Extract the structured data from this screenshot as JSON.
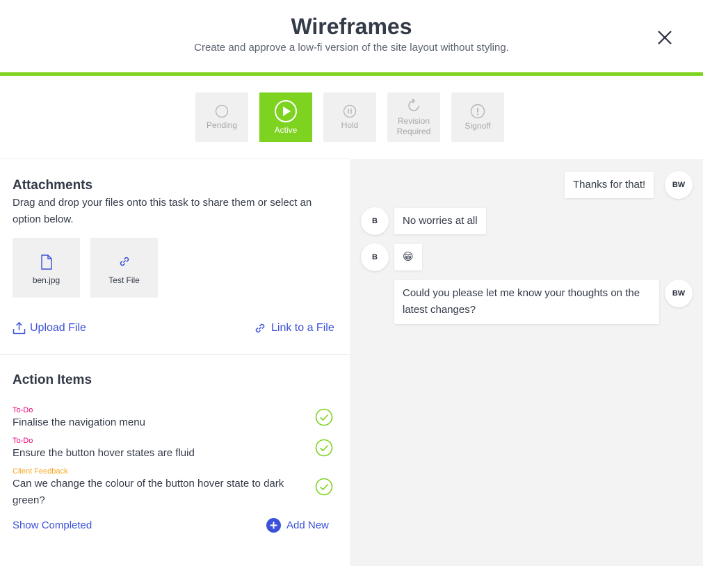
{
  "header": {
    "title": "Wireframes",
    "subtitle": "Create and approve a low-fi version of the site layout without styling."
  },
  "colors": {
    "accent": "#7ed321",
    "link": "#3a51d8",
    "todo_tag": "#e6007a",
    "feedback_tag": "#f5a623"
  },
  "statuses": [
    {
      "label": "Pending",
      "icon": "circle-icon",
      "active": false
    },
    {
      "label": "Active",
      "icon": "play-icon",
      "active": true
    },
    {
      "label": "Hold",
      "icon": "pause-icon",
      "active": false
    },
    {
      "label": "Revision Required",
      "icon": "refresh-icon",
      "active": false
    },
    {
      "label": "Signoff",
      "icon": "alert-icon",
      "active": false
    }
  ],
  "attachments": {
    "title": "Attachments",
    "description": "Drag and drop your files onto this task to share them or select an option below.",
    "files": [
      {
        "name": "ben.jpg",
        "icon": "file-icon"
      },
      {
        "name": "Test File",
        "icon": "link-icon"
      }
    ],
    "upload_label": "Upload File",
    "link_label": "Link to a File"
  },
  "action_items": {
    "title": "Action Items",
    "items": [
      {
        "tag": "To-Do",
        "text": "Finalise the navigation menu"
      },
      {
        "tag": "To-Do",
        "text": "Ensure the button hover states are fluid"
      },
      {
        "tag": "Client Feedback",
        "text": "Can we change the colour of the button hover state to dark green?"
      }
    ],
    "show_completed": "Show Completed",
    "add_new": "Add New"
  },
  "chat": {
    "messages": [
      {
        "author": "BW",
        "text": "Thanks for that!"
      },
      {
        "author": "B",
        "text": "No worries at all"
      },
      {
        "author": "B",
        "text": "😁"
      },
      {
        "author": "BW",
        "text": "Could you please let me know your thoughts on the latest changes?"
      }
    ]
  }
}
